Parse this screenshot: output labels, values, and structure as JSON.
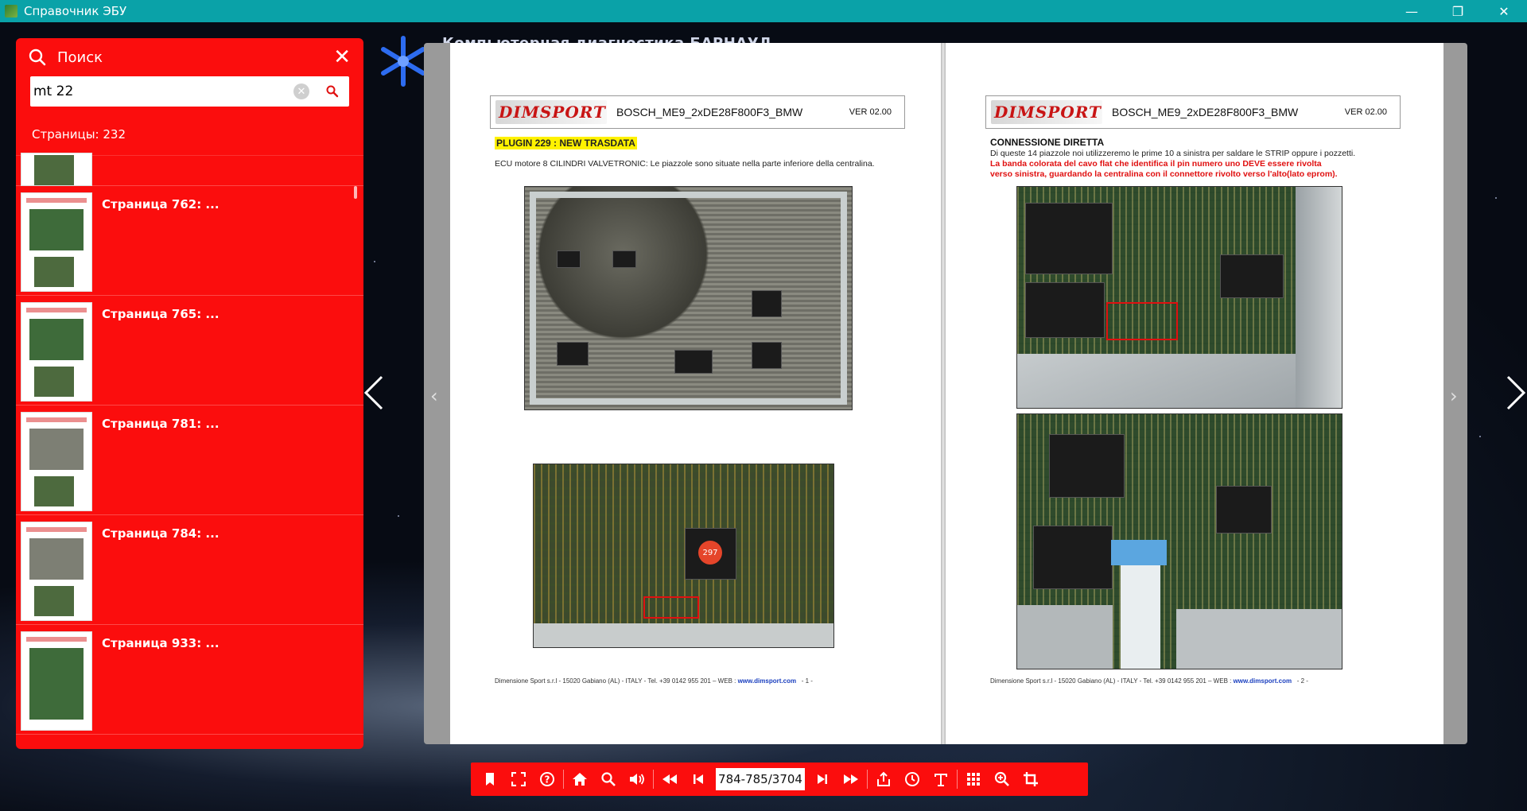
{
  "window": {
    "title": "Справочник ЭБУ",
    "controls": {
      "minimize": "—",
      "restore": "❐",
      "close": "✕"
    }
  },
  "background": {
    "caption": "Компьютерная диагностика БАРНАУЛ"
  },
  "search_panel": {
    "title": "Поиск",
    "query": "mt 22",
    "count_text": "Страницы: 232",
    "results": [
      {
        "label": ""
      },
      {
        "label": "Страница 762:   ..."
      },
      {
        "label": "Страница 765:   ..."
      },
      {
        "label": "Страница 781:   ..."
      },
      {
        "label": "Страница 784:   ..."
      },
      {
        "label": "Страница 933:   ..."
      }
    ]
  },
  "book": {
    "left_page": {
      "logo": "DIMSPORT",
      "doc_title": "BOSCH_ME9_2xDE28F800F3_BMW",
      "version": "VER 02.00",
      "plugin_tag": "PLUGIN 229 : NEW TRASDATA",
      "text": "ECU motore 8 CILINDRI VALVETRONIC: Le piazzole sono situate nella parte inferiore della centralina.",
      "sticker": "297",
      "footer_company": "Dimensione Sport s.r.l - 15020 Gabiano (AL) - ITALY - Tel. +39 0142 955 201 – WEB : ",
      "footer_web": "www.dimsport.com",
      "footer_page": "- 1 -"
    },
    "right_page": {
      "logo": "DIMSPORT",
      "doc_title": "BOSCH_ME9_2xDE28F800F3_BMW",
      "version": "VER 02.00",
      "heading": "CONNESSIONE DIRETTA",
      "text": "Di queste 14 piazzole noi utilizzeremo le prime 10 a sinistra per saldare le STRIP oppure i pozzetti.",
      "red_text_1": "La banda colorata del cavo flat che identifica il pin numero uno DEVE essere rivolta",
      "red_text_2": "verso sinistra, guardando la centralina con il connettore rivolto verso l'alto(lato eprom).",
      "footer_company": "Dimensione Sport s.r.l - 15020 Gabiano (AL) - ITALY - Tel. +39 0142 955 201 – WEB : ",
      "footer_web": "www.dimsport.com",
      "footer_page": "- 2 -"
    }
  },
  "toolbar": {
    "page_indicator": "784-785/3704",
    "icons": [
      "bookmark-icon",
      "fullscreen-icon",
      "help-icon",
      "home-icon",
      "zoom-search-icon",
      "sound-icon",
      "first-page-icon",
      "prev-page-icon",
      "next-page-icon",
      "last-page-icon",
      "share-icon",
      "autoplay-icon",
      "text-icon",
      "thumbnails-icon",
      "zoom-in-icon",
      "crop-icon"
    ]
  },
  "colors": {
    "accent": "#fb0d0d",
    "titlebar": "#0aa2a8"
  }
}
